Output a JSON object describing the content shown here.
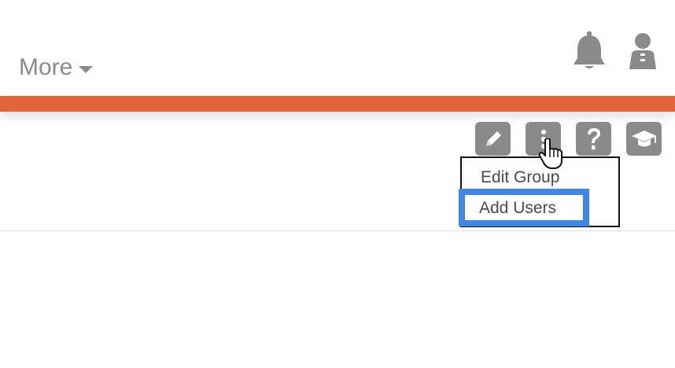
{
  "header": {
    "more_label": "More",
    "caret_icon": "caret-down-icon",
    "notification_icon": "bell-icon",
    "profile_icon": "user-icon"
  },
  "colors": {
    "accent_bar": "#e06638",
    "toolbar_button": "#8a8a8a",
    "highlight": "#3f86e6",
    "text_muted": "#8a8a8a"
  },
  "toolbar": {
    "buttons": [
      {
        "icon": "pencil-icon",
        "label": "edit"
      },
      {
        "icon": "more-vertical-icon",
        "label": "more actions"
      },
      {
        "icon": "help-icon",
        "label": "help"
      },
      {
        "icon": "graduation-cap-icon",
        "label": "learn"
      }
    ]
  },
  "dropdown": {
    "items": [
      {
        "label": "Edit Group",
        "highlighted": false
      },
      {
        "label": "Add Users",
        "highlighted": true
      }
    ]
  }
}
